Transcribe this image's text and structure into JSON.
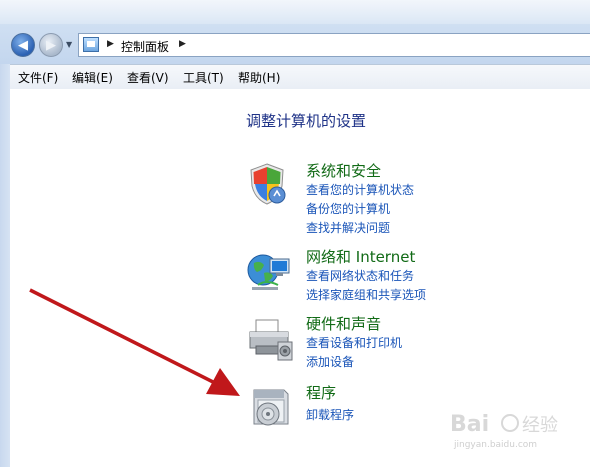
{
  "address_bar": {
    "path": "控制面板"
  },
  "menu": {
    "items": [
      {
        "label": "文件(F)"
      },
      {
        "label": "编辑(E)"
      },
      {
        "label": "查看(V)"
      },
      {
        "label": "工具(T)"
      },
      {
        "label": "帮助(H)"
      }
    ]
  },
  "main": {
    "heading": "调整计算机的设置",
    "categories": [
      {
        "title": "系统和安全",
        "icon": "shield-icon",
        "links": [
          "查看您的计算机状态",
          "备份您的计算机",
          "查找并解决问题"
        ]
      },
      {
        "title": "网络和 Internet",
        "icon": "network-globe-icon",
        "links": [
          "查看网络状态和任务",
          "选择家庭组和共享选项"
        ]
      },
      {
        "title": "硬件和声音",
        "icon": "printer-icon",
        "links": [
          "查看设备和打印机",
          "添加设备"
        ]
      },
      {
        "title": "程序",
        "icon": "programs-disc-icon",
        "links": [
          "卸载程序"
        ]
      }
    ]
  },
  "annotation": {
    "arrow_color": "#c0181b"
  },
  "watermark": {
    "text": "jingyan.baidu.com"
  }
}
